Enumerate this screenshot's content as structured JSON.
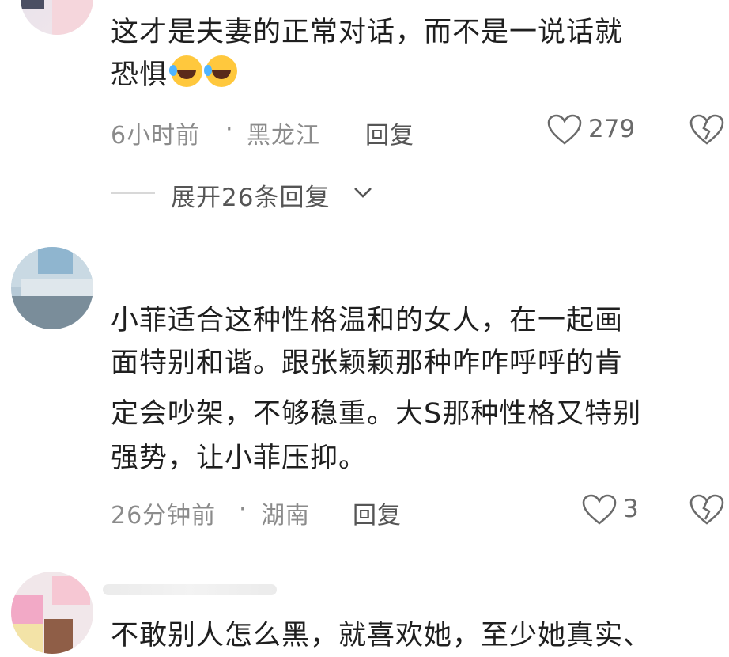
{
  "comments": [
    {
      "lines": [
        "这才是夫妻的正常对话，而不是一说话就",
        "恐惧"
      ],
      "time": "6小时前",
      "sep": "·",
      "location": "黑龙江",
      "reply_label": "回复",
      "likes": "279",
      "expand_label": "展开26条回复",
      "icons": [
        "laugh-emoji-icon",
        "heart-outline-icon",
        "broken-heart-icon",
        "chevron-down-icon"
      ]
    },
    {
      "lines": [
        "小菲适合这种性格温和的女人，在一起画",
        "面特别和谐。跟张颖颖那种咋咋呼呼的肯",
        "定会吵架，不够稳重。大S那种性格又特别",
        "强势，让小菲压抑。"
      ],
      "time": "26分钟前",
      "sep": "·",
      "location": "湖南",
      "reply_label": "回复",
      "likes": "3",
      "icons": [
        "heart-outline-icon",
        "broken-heart-icon"
      ]
    },
    {
      "lines": [
        "不敢别人怎么黑，就喜欢她，至少她真实、"
      ]
    }
  ],
  "colors": {
    "text": "#1f1f1f",
    "meta": "#8b8b8b",
    "icon": "#6a6a6a"
  }
}
